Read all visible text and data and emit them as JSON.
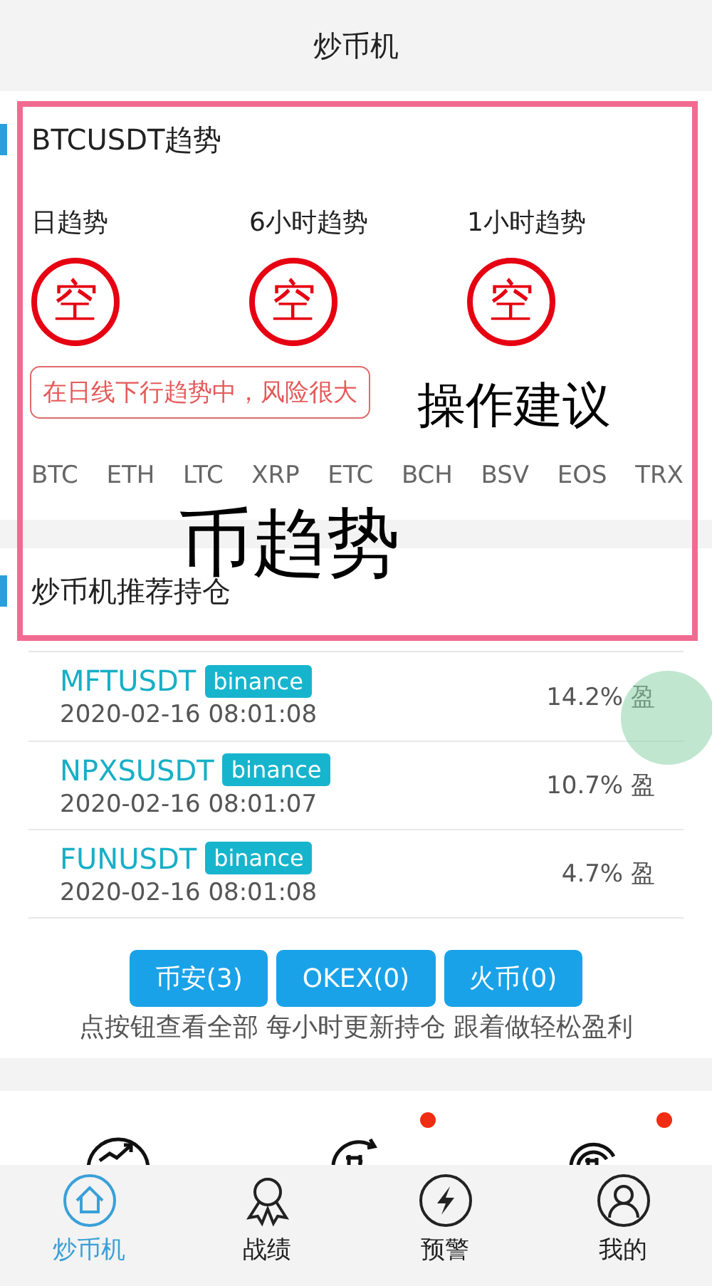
{
  "header": {
    "title": "炒币机"
  },
  "trend_section": {
    "title": "BTCUSDT趋势",
    "trends": [
      {
        "label": "日趋势",
        "signal": "空"
      },
      {
        "label": "6小时趋势",
        "signal": "空"
      },
      {
        "label": "1小时趋势",
        "signal": "空"
      }
    ],
    "advice": "在日线下行趋势中，风险很大",
    "coins": [
      "BTC",
      "ETH",
      "LTC",
      "XRP",
      "ETC",
      "BCH",
      "BSV",
      "EOS",
      "TRX"
    ]
  },
  "holdings": {
    "title": "炒币机推荐持仓",
    "rows": [
      {
        "symbol": "MFTUSDT",
        "exchange": "binance",
        "time": "2020-02-16 08:01:08",
        "return": "14.2%",
        "result": "盈"
      },
      {
        "symbol": "NPXSUSDT",
        "exchange": "binance",
        "time": "2020-02-16 08:01:07",
        "return": "10.7%",
        "result": "盈"
      },
      {
        "symbol": "FUNUSDT",
        "exchange": "binance",
        "time": "2020-02-16 08:01:08",
        "return": "4.7%",
        "result": "盈"
      }
    ],
    "buttons": [
      "币安(3)",
      "OKEX(0)",
      "火币(0)"
    ],
    "hint": "点按钮查看全部 每小时更新持仓 跟着做轻松盈利"
  },
  "features": [
    {
      "kind": "chart",
      "dot": false
    },
    {
      "kind": "cycle",
      "dot": true
    },
    {
      "kind": "signal",
      "dot": true
    }
  ],
  "annotations": [
    {
      "kind": "advice",
      "text": "操作建议"
    },
    {
      "kind": "section",
      "text": "币趋势"
    }
  ],
  "tabs": [
    {
      "label": "炒币机",
      "selected": true
    },
    {
      "label": "战绩",
      "selected": false
    },
    {
      "label": "预警",
      "selected": false
    },
    {
      "label": "我的",
      "selected": false
    }
  ]
}
